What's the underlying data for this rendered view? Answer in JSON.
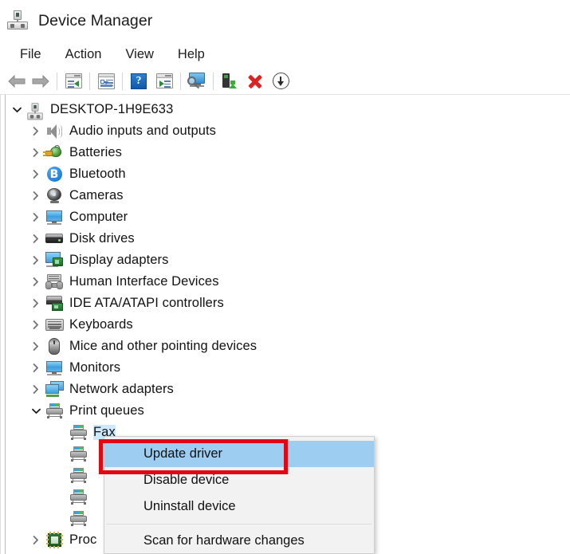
{
  "window": {
    "title": "Device Manager",
    "icon": "device-node-icon"
  },
  "menubar": {
    "items": [
      {
        "label": "File"
      },
      {
        "label": "Action"
      },
      {
        "label": "View"
      },
      {
        "label": "Help"
      }
    ]
  },
  "toolbar": {
    "buttons": [
      {
        "name": "back-button",
        "icon": "back-arrow-icon",
        "tooltip": "Back"
      },
      {
        "name": "forward-button",
        "icon": "forward-arrow-icon",
        "tooltip": "Forward"
      },
      {
        "name": "show-hide-console-tree-button",
        "icon": "console-tree-icon",
        "tooltip": "Show/Hide Console Tree"
      },
      {
        "name": "properties-button",
        "icon": "properties-icon",
        "tooltip": "Properties"
      },
      {
        "name": "help-button",
        "icon": "help-question-icon",
        "tooltip": "Help"
      },
      {
        "name": "show-hide-action-pane-button",
        "icon": "action-pane-icon",
        "tooltip": "Show/Hide Action Pane"
      },
      {
        "name": "scan-for-hardware-changes-button",
        "icon": "scan-monitor-magnifier-icon",
        "tooltip": "Scan for hardware changes"
      },
      {
        "name": "update-driver-button",
        "icon": "update-driver-device-icon",
        "tooltip": "Update driver"
      },
      {
        "name": "uninstall-device-button",
        "icon": "red-x-icon",
        "tooltip": "Uninstall device"
      },
      {
        "name": "disable-device-button",
        "icon": "circle-down-arrow-icon",
        "tooltip": "Disable device"
      }
    ]
  },
  "tree": {
    "root": {
      "label": "DESKTOP-1H9E633",
      "icon": "computer-node-icon",
      "expanded": true,
      "chevron": "chevron-down"
    },
    "nodes": [
      {
        "label": "Audio inputs and outputs",
        "icon": "speaker-icon",
        "expanded": false,
        "chevron": "chevron-right",
        "indent": 1
      },
      {
        "label": "Batteries",
        "icon": "battery-plug-icon",
        "expanded": false,
        "chevron": "chevron-right",
        "indent": 1
      },
      {
        "label": "Bluetooth",
        "icon": "bluetooth-icon",
        "expanded": false,
        "chevron": "chevron-right",
        "indent": 1
      },
      {
        "label": "Cameras",
        "icon": "camera-icon",
        "expanded": false,
        "chevron": "chevron-right",
        "indent": 1
      },
      {
        "label": "Computer",
        "icon": "monitor-icon",
        "expanded": false,
        "chevron": "chevron-right",
        "indent": 1
      },
      {
        "label": "Disk drives",
        "icon": "disk-drive-icon",
        "expanded": false,
        "chevron": "chevron-right",
        "indent": 1
      },
      {
        "label": "Display adapters",
        "icon": "display-adapter-icon",
        "expanded": false,
        "chevron": "chevron-right",
        "indent": 1
      },
      {
        "label": "Human Interface Devices",
        "icon": "hid-gamepad-icon",
        "expanded": false,
        "chevron": "chevron-right",
        "indent": 1
      },
      {
        "label": "IDE ATA/ATAPI controllers",
        "icon": "ide-controller-icon",
        "expanded": false,
        "chevron": "chevron-right",
        "indent": 1
      },
      {
        "label": "Keyboards",
        "icon": "keyboard-icon",
        "expanded": false,
        "chevron": "chevron-right",
        "indent": 1
      },
      {
        "label": "Mice and other pointing devices",
        "icon": "mouse-icon",
        "expanded": false,
        "chevron": "chevron-right",
        "indent": 1
      },
      {
        "label": "Monitors",
        "icon": "monitor-icon",
        "expanded": false,
        "chevron": "chevron-right",
        "indent": 1
      },
      {
        "label": "Network adapters",
        "icon": "network-adapter-icon",
        "expanded": false,
        "chevron": "chevron-right",
        "indent": 1
      },
      {
        "label": "Print queues",
        "icon": "printer-icon",
        "expanded": true,
        "chevron": "chevron-down",
        "indent": 1
      }
    ],
    "print_queue_children": [
      {
        "label": "Fax",
        "icon": "printer-icon",
        "selected": true
      },
      {
        "label": "",
        "icon": "printer-icon",
        "selected": false
      },
      {
        "label": "",
        "icon": "printer-icon",
        "selected": false
      },
      {
        "label": "",
        "icon": "printer-icon",
        "selected": false
      },
      {
        "label": "",
        "icon": "printer-icon",
        "selected": false
      }
    ],
    "last_node": {
      "label": "Proc",
      "icon": "processor-chip-icon",
      "expanded": false,
      "chevron": "chevron-right",
      "indent": 1
    }
  },
  "context_menu": {
    "items": [
      {
        "label": "Update driver",
        "highlighted": true,
        "separator_after": false
      },
      {
        "label": "Disable device",
        "highlighted": false,
        "separator_after": false
      },
      {
        "label": "Uninstall device",
        "highlighted": false,
        "separator_after": true
      },
      {
        "label": "Scan for hardware changes",
        "highlighted": false,
        "separator_after": false
      }
    ]
  },
  "annotation": {
    "type": "rectangle-highlight",
    "target": "Update driver",
    "color": "#e30613"
  },
  "colors": {
    "selection_blue": "#cde8ff",
    "menu_highlight_blue": "#9ecdf2",
    "annotation_red": "#e30613",
    "menu_background": "#f2f2f2",
    "window_background": "#ffffff"
  }
}
